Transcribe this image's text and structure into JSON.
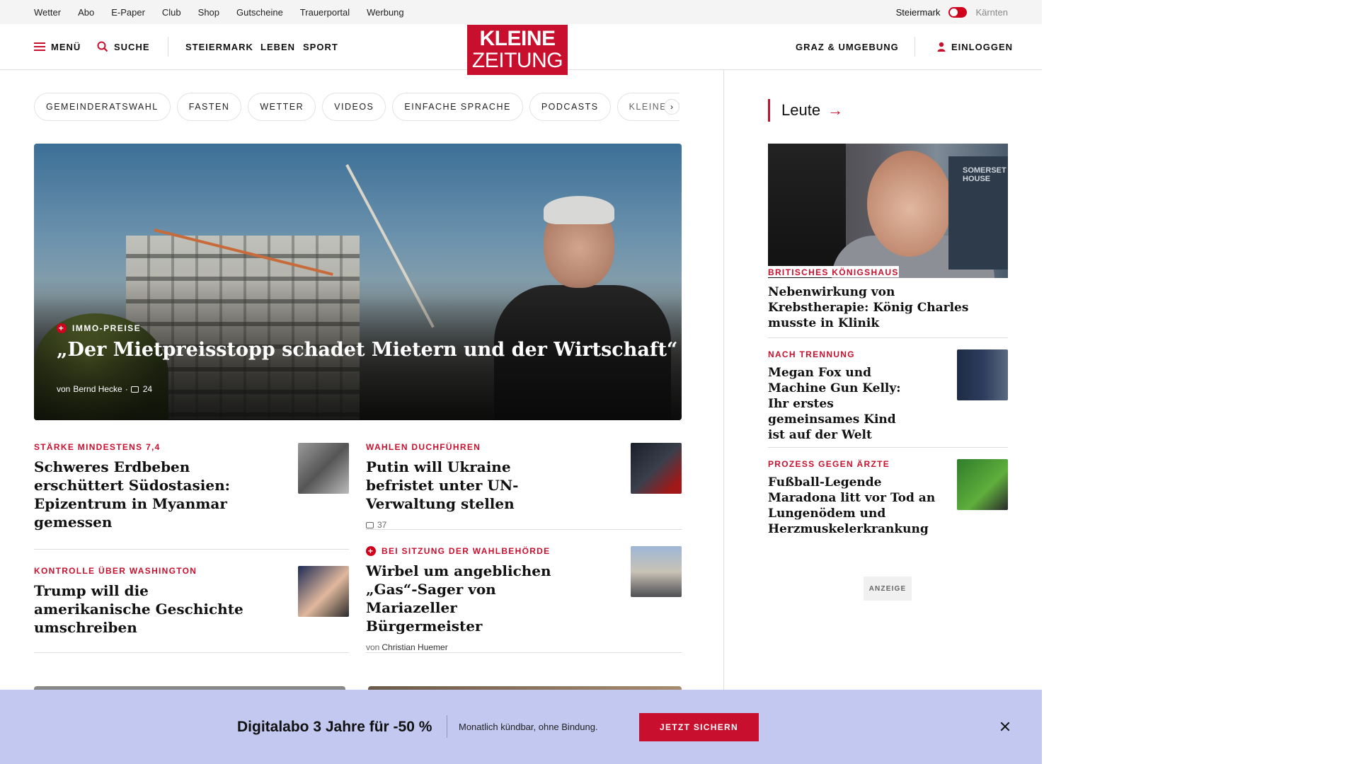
{
  "utility": {
    "links": [
      "Wetter",
      "Abo",
      "E-Paper",
      "Club",
      "Shop",
      "Gutscheine",
      "Trauerportal",
      "Werbung"
    ],
    "region_active": "Steiermark",
    "region_inactive": "Kärnten"
  },
  "header": {
    "menu_label": "MENÜ",
    "search_label": "SUCHE",
    "nav": [
      "STEIERMARK",
      "LEBEN",
      "SPORT"
    ],
    "logo_line1": "KLEINE",
    "logo_line2": "ZEITUNG",
    "region_link": "GRAZ & UMGEBUNG",
    "login_label": "EINLOGGEN"
  },
  "chips": [
    "GEMEINDERATSWAHL",
    "FASTEN",
    "WETTER",
    "VIDEOS",
    "EINFACHE SPRACHE",
    "PODCASTS",
    "KLEINE KINDE"
  ],
  "hero": {
    "kicker": "IMMO-PREISE",
    "headline": "„Der Mietpreisstopp schadet Mietern und der Wirtschaft“",
    "byline_prefix": "von",
    "author": "Bernd Hecke",
    "comments": "24"
  },
  "teasers": [
    {
      "kicker": "STÄRKE MINDESTENS 7,4",
      "title": "Schweres Erdbeben erschüttert Südostasien: Epizentrum in Myanmar gemessen"
    },
    {
      "kicker": "WAHLEN DUCHFÜHREN",
      "title": "Putin will Ukraine befristet unter UN-Verwaltung stellen",
      "comments": "37"
    },
    {
      "kicker": "KONTROLLE ÜBER WASHINGTON",
      "title": "Trump will die amerikanische Geschichte umschreiben"
    },
    {
      "kicker": "BEI SITZUNG DER WAHLBEHÖRDE",
      "title": "Wirbel um angeblichen „Gas“-Sager von Mariazeller Bürgermeister",
      "byline_prefix": "von",
      "author": "Christian Huemer"
    }
  ],
  "sidebar": {
    "heading": "Leute",
    "image_sign": "SOMERSET HOUSE",
    "items": [
      {
        "kicker": "BRITISCHES KÖNIGSHAUS",
        "title": "Nebenwirkung von Krebstherapie: König Charles musste in Klinik"
      },
      {
        "kicker": "NACH TRENNUNG",
        "title": "Megan Fox und Machine Gun Kelly: Ihr erstes gemeinsames Kind ist auf der Welt"
      },
      {
        "kicker": "PROZESS GEGEN ÄRZTE",
        "title": "Fußball-Legende Maradona litt vor Tod an Lungenödem und Herzmuskelerkrankung"
      }
    ],
    "ad_label": "ANZEIGE"
  },
  "banner": {
    "offer": "Digitalabo 3 Jahre für -50 %",
    "subtitle": "Monatlich kündbar, ohne Bindung.",
    "cta": "JETZT SICHERN"
  },
  "colors": {
    "brand_red": "#c8102e",
    "banner_bg": "#c2c8ef"
  }
}
